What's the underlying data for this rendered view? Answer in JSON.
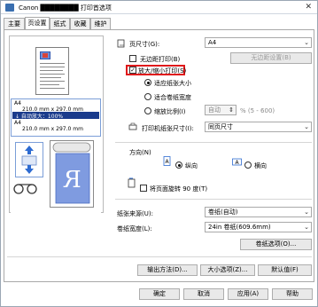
{
  "window": {
    "title": "Canon ████████ 打印首选项",
    "close": "✕"
  },
  "tabs": [
    {
      "label": "主要"
    },
    {
      "label": "页设置"
    },
    {
      "label": "纸式"
    },
    {
      "label": "收藏"
    },
    {
      "label": "维护"
    }
  ],
  "info": {
    "line1": "A4",
    "line2": "210.0 mm x 297.0 mm",
    "line3": "↓ 自动放大：100%",
    "line4": "A4",
    "line5": "210.0 mm x 297.0 mm"
  },
  "page_size": {
    "label": "页尺寸(G):",
    "value": "A4"
  },
  "borderless": {
    "label": "无边距打印(B)",
    "checked": false
  },
  "borderless_settings_button": "无边距设置(B)",
  "scaled": {
    "label": "放大/缩小打印(S)",
    "checked": true
  },
  "scale_options": [
    {
      "label": "适应纸张大小",
      "selected": true
    },
    {
      "label": "适合卷纸宽度",
      "selected": false
    },
    {
      "label": "缩放比例(I)",
      "selected": false
    }
  ],
  "scale_value": "自动",
  "scale_range": "% (5 - 600)",
  "printer_paper_size": {
    "label": "打印机纸张尺寸(I):",
    "value": "同页尺寸"
  },
  "orientation": {
    "label": "方向(N)",
    "portrait": "纵向",
    "landscape": "横向",
    "selected": "portrait"
  },
  "rotate": {
    "label": "将页面旋转 90 度(T)",
    "checked": false
  },
  "paper_source": {
    "label": "纸张来源(U):",
    "value": "卷纸(自动)"
  },
  "roll_width": {
    "label": "卷纸宽度(L):",
    "value": "24in 卷纸(609.6mm)"
  },
  "roll_options_button": "卷纸选项(O)...",
  "output_method_button": "输出方法(D)...",
  "size_options_button": "大小选项(Z)...",
  "defaults_button": "默认值(F)",
  "footer": {
    "ok": "确定",
    "cancel": "取消",
    "apply": "应用(A)",
    "help": "帮助"
  },
  "colors": {
    "accent": "#1a3b8c",
    "highlight": "#e0191b",
    "preview_blue": "#6f90d8"
  }
}
